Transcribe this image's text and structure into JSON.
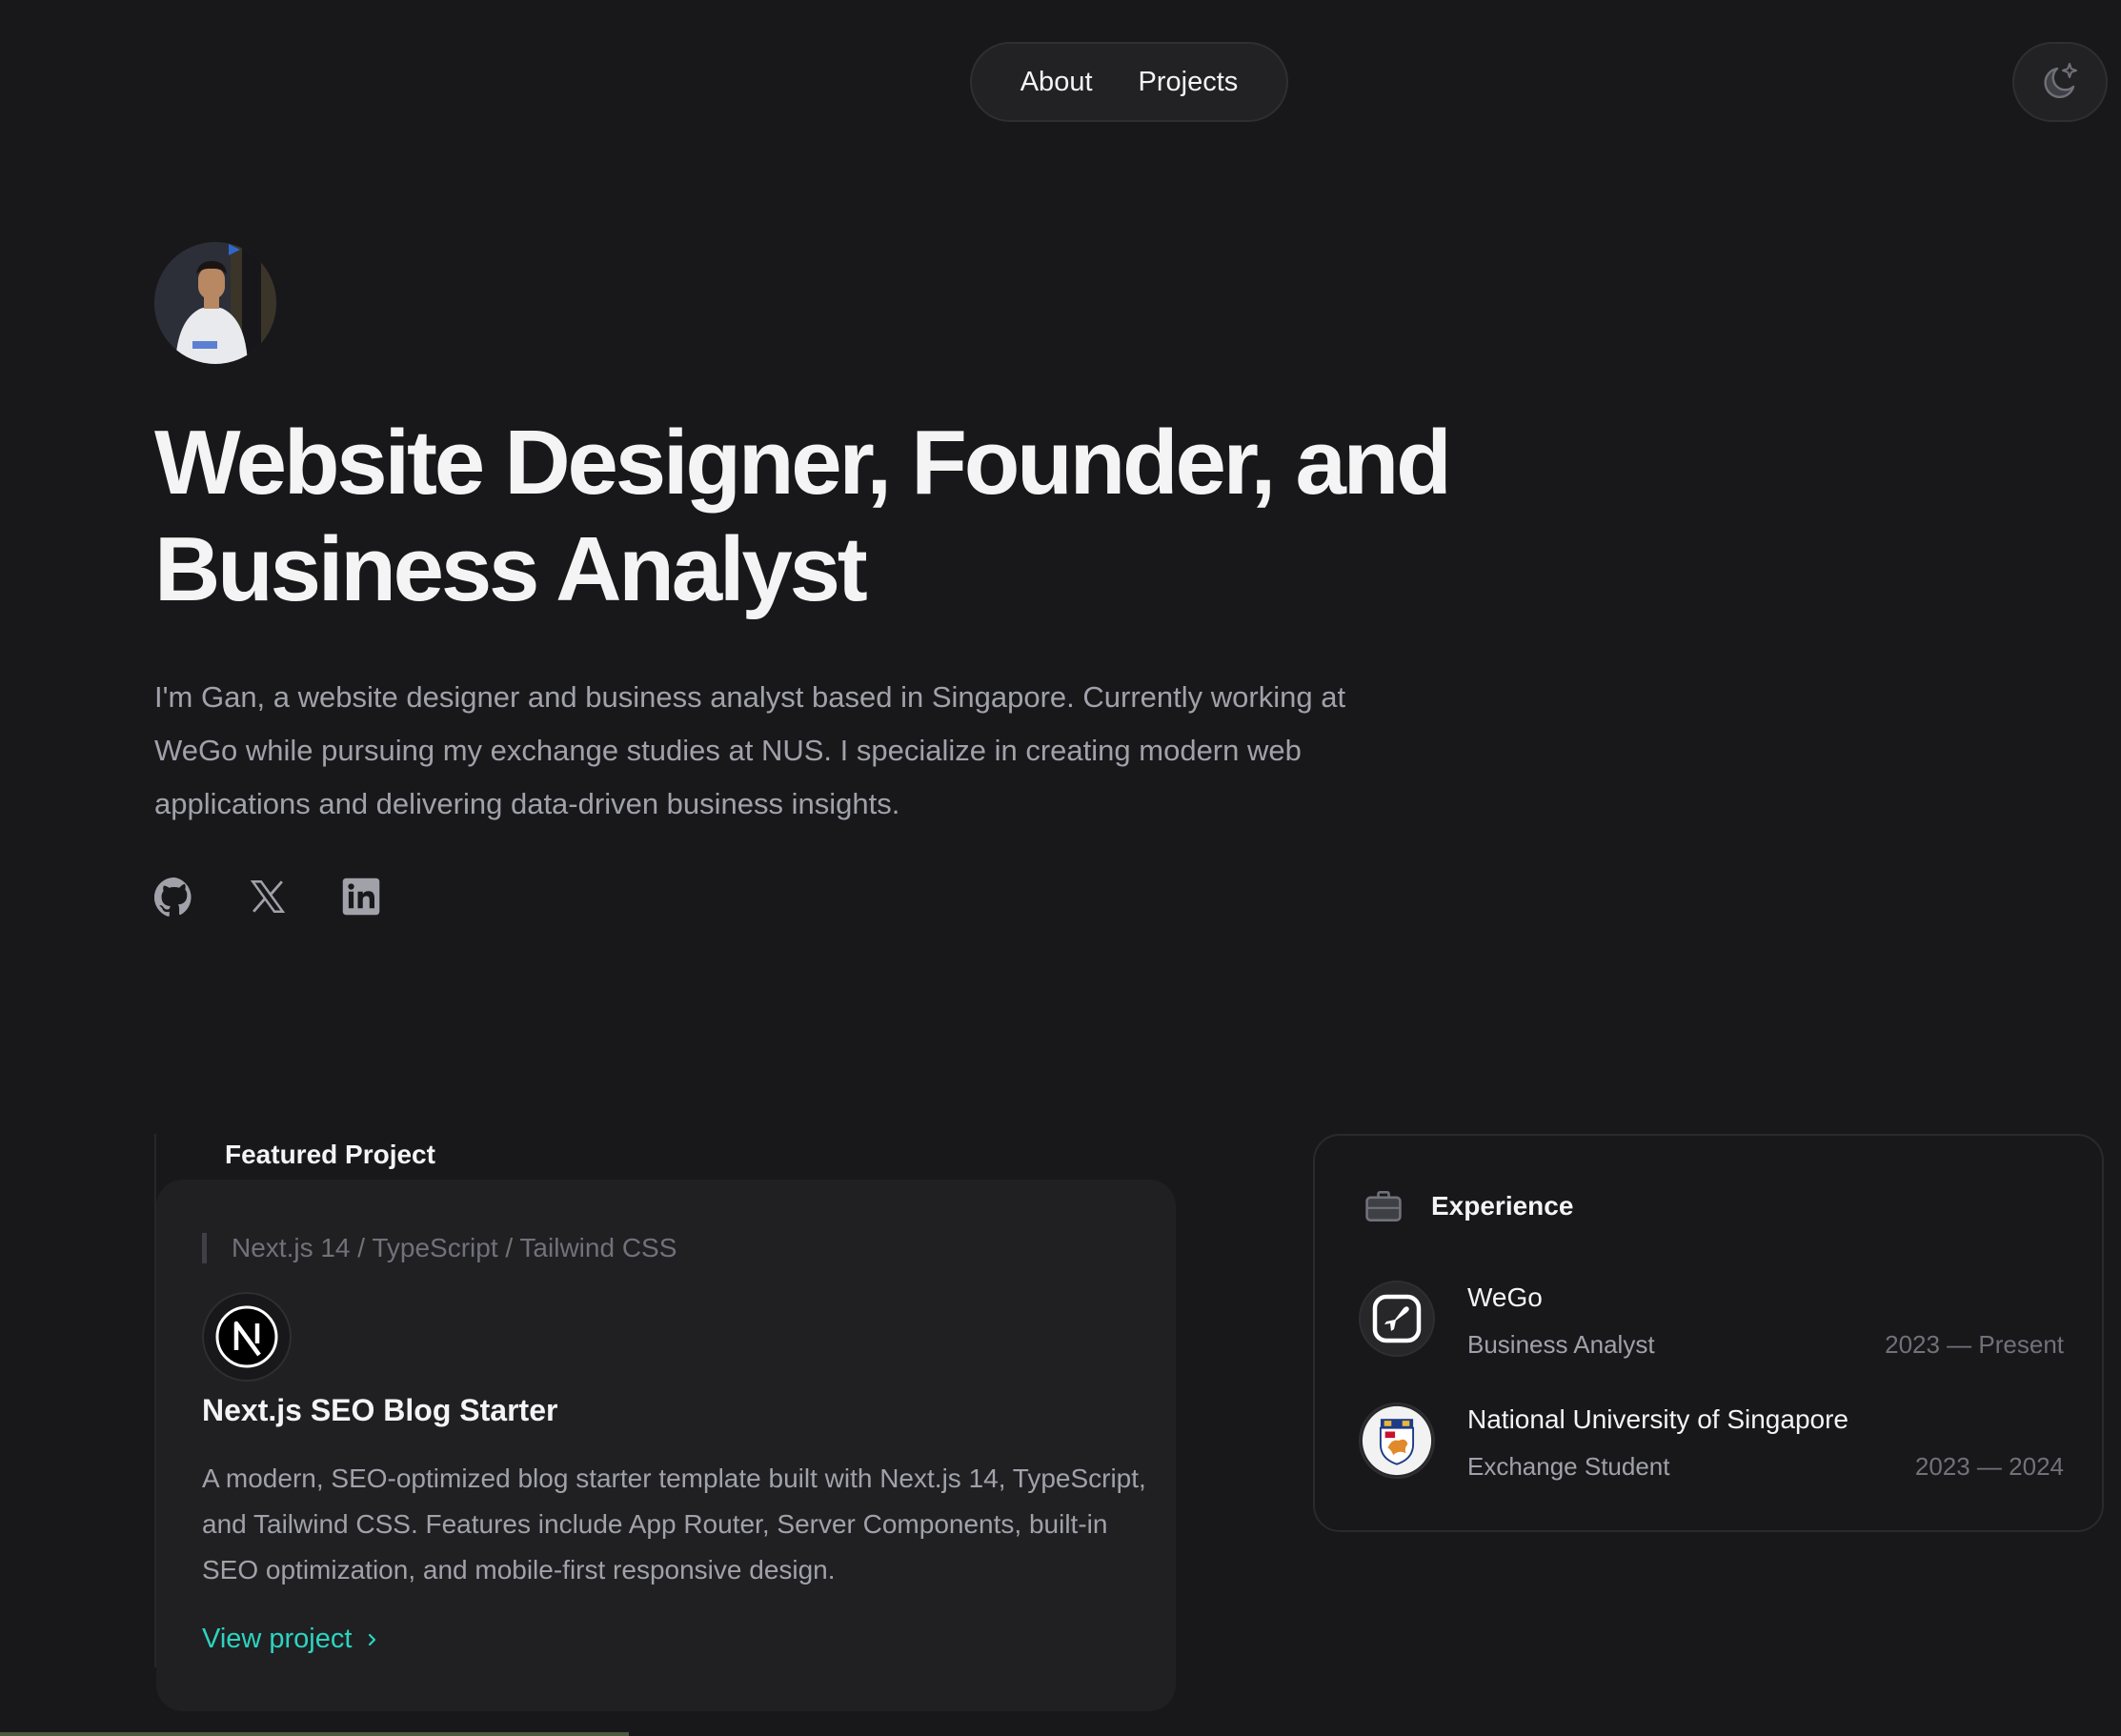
{
  "nav": {
    "links": [
      "About",
      "Projects"
    ],
    "theme_toggle_icon": "moon-sparkle-icon"
  },
  "hero": {
    "avatar_icon": "profile-photo",
    "headline": "Website Designer, Founder, and Business Analyst",
    "intro": "I'm Gan, a website designer and business analyst based in Singapore. Currently working at WeGo while pursuing my exchange studies at NUS. I specialize in creating modern web applications and delivering data-driven business insights.",
    "socials": [
      "github-icon",
      "x-icon",
      "linkedin-icon"
    ]
  },
  "featured": {
    "heading": "Featured Project",
    "stack": "Next.js 14 / TypeScript / Tailwind CSS",
    "logo_icon": "nextjs-logo-icon",
    "title": "Next.js SEO Blog Starter",
    "description": "A modern, SEO-optimized blog starter template built with Next.js 14, TypeScript, and Tailwind CSS. Features include App Router, Server Components, built-in SEO optimization, and mobile-first responsive design.",
    "link_label": "View project",
    "link_color": "#2dd4bf"
  },
  "experience": {
    "title": "Experience",
    "icon": "briefcase-icon",
    "items": [
      {
        "org": "WeGo",
        "role": "Business Analyst",
        "dates": "2023 — Present",
        "logo_icon": "wego-plane-icon"
      },
      {
        "org": "National University of Singapore",
        "role": "Exchange Student",
        "dates": "2023 — 2024",
        "logo_icon": "nus-crest-icon"
      }
    ]
  },
  "colors": {
    "background": "#18181b",
    "accent": "#2dd4bf",
    "text_primary": "#f4f4f5",
    "text_secondary": "#a1a1aa"
  }
}
